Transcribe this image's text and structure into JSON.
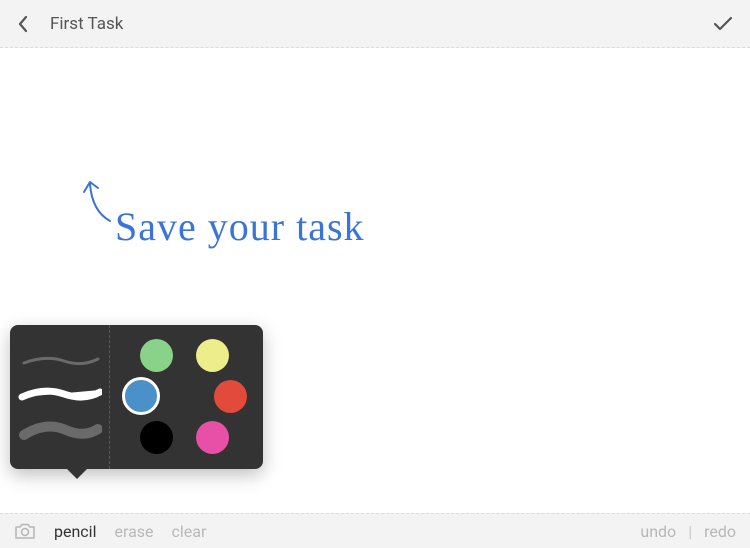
{
  "header": {
    "title": "First Task"
  },
  "canvas": {
    "hint_text": "Save your task"
  },
  "toolbar": {
    "pencil": "pencil",
    "erase": "erase",
    "clear": "clear",
    "undo": "undo",
    "redo": "redo"
  },
  "popover": {
    "colors": {
      "green": "#8ad28a",
      "yellow": "#eeed8c",
      "blue": "#4a90c9",
      "red": "#e24a3b",
      "black": "#000000",
      "pink": "#e84fa6"
    },
    "selected_color": "blue",
    "selected_stroke": 1
  }
}
